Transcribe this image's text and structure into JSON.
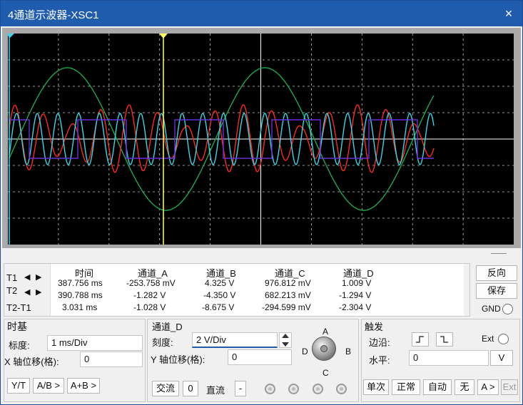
{
  "window": {
    "title": "4通道示波器-XSC1",
    "close_icon": "×"
  },
  "measurements": {
    "row_labels": [
      "T1",
      "T2",
      "T2-T1"
    ],
    "columns": [
      "时间",
      "通道_A",
      "通道_B",
      "通道_C",
      "通道_D"
    ],
    "rows": [
      [
        "387.756 ms",
        "-253.758 mV",
        "4.325 V",
        "976.812 mV",
        "1.009 V"
      ],
      [
        "390.788 ms",
        "-1.282 V",
        "-4.350 V",
        "682.213 mV",
        "-1.294 V"
      ],
      [
        "3.031 ms",
        "-1.028 V",
        "-8.675 V",
        "-294.599 mV",
        "-2.304 V"
      ]
    ],
    "arrow_left": "◀",
    "arrow_right": "▶"
  },
  "right_buttons": {
    "reverse": "反向",
    "save": "保存",
    "gnd": "GND"
  },
  "timebase": {
    "title": "时基",
    "scale_label": "标度:",
    "scale_value": "1 ms/Div",
    "xpos_label": "X 轴位移(格):",
    "xpos_value": "0",
    "buttons": [
      "Y/T",
      "A/B >",
      "A+B >"
    ]
  },
  "channel": {
    "title": "通道_D",
    "scale_label": "刻度:",
    "scale_value": "2  V/Div",
    "ypos_label": "Y 轴位移(格):",
    "ypos_value": "0",
    "buttons": {
      "ac": "交流",
      "zero": "0",
      "dc": "直流",
      "minus": "-"
    },
    "knob": {
      "a": "A",
      "b": "B",
      "c": "C",
      "d": "D"
    }
  },
  "trigger": {
    "title": "触发",
    "edge_label": "边沿:",
    "ext_label": "Ext",
    "level_label": "水平:",
    "level_value": "0",
    "level_unit": "V",
    "buttons": [
      "单次",
      "正常",
      "自动",
      "无",
      "A >",
      "Ext"
    ]
  },
  "colors": {
    "channel_a": "#ff2a1a",
    "channel_b": "#3ad4e8",
    "channel_c": "#1fa84a",
    "channel_d": "#6b2fd6",
    "cursor": "#ffff66",
    "grid": "#c8c8c8"
  }
}
